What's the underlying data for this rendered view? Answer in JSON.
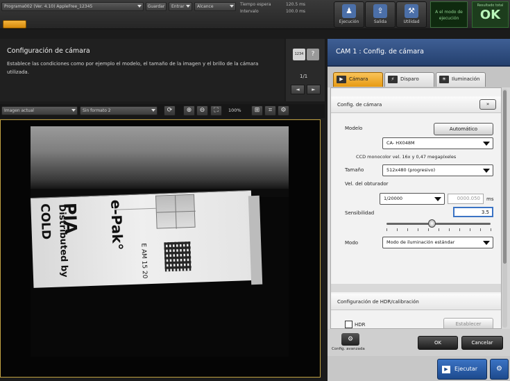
{
  "topbar": {
    "program_select": "Programa002 (Ver. 4.10) AppleFree_12345",
    "program_button": "Guardar",
    "dropdown_a": "Entrar",
    "dropdown_b": "Alcance",
    "time_labels": [
      "Tiempo espera",
      "Intervalo"
    ],
    "time_values": [
      "120.5 ms",
      "100.0 ms"
    ],
    "buttons": [
      {
        "label": "Ejecución",
        "icon": "person-icon"
      },
      {
        "label": "Salida",
        "icon": "export-icon"
      },
      {
        "label": "Utilidad",
        "icon": "tools-icon"
      }
    ],
    "mode_text": "A el modo de ejecución",
    "ok_small": "Resultado total",
    "ok_big": "OK"
  },
  "description": {
    "title": "Configuración de cámara",
    "text": "Establece las condiciones como por ejemplo el modelo, el tamaño de la imagen y el brillo de la cámara utilizada.",
    "help_icon_1": "1234",
    "help_icon_2": "?",
    "page": "1/1",
    "prev": "◄",
    "next": "►"
  },
  "imagebar": {
    "image_select": "Imagen actual",
    "format_select": "Sin formato 2",
    "zoom": "100%"
  },
  "panel": {
    "title": "CAM 1 : Config. de cámara",
    "tabs": [
      "Cámara",
      "Disparo",
      "Iluminación"
    ],
    "section1": "Config. de cámara",
    "section1_btn": "»",
    "model_label": "Modelo",
    "auto_button": "Automático",
    "model_value": "CA- HX048M",
    "model_desc": "CCD monocolor vel. 16x y 0,47 megapíxeles",
    "size_label": "Tamaño",
    "size_value": "512x480 (progresivo)",
    "shutter_label": "Vel. del obturador",
    "shutter_value": "1/20000",
    "shutter_ms_value": "0000.050",
    "shutter_ms_unit": "ms",
    "sensitivity_label": "Sensibilidad",
    "sensitivity_value": "3.5",
    "sensitivity_level": 0.43,
    "mode_label": "Modo",
    "mode_value": "Modo de iluminación estándar",
    "section2": "Configuración de HDR/calibración",
    "hdr_label": "HDR",
    "set_button": "Establecer",
    "advanced_label": "Config. avanzada",
    "ok_button": "OK",
    "cancel_button": "Cancelar",
    "run_button": "Ejecutar"
  },
  "camera_image": {
    "carton_texts": [
      "COLD",
      "Distributed by",
      "PIA",
      "e-Pak°",
      "E AM 15 20"
    ]
  }
}
